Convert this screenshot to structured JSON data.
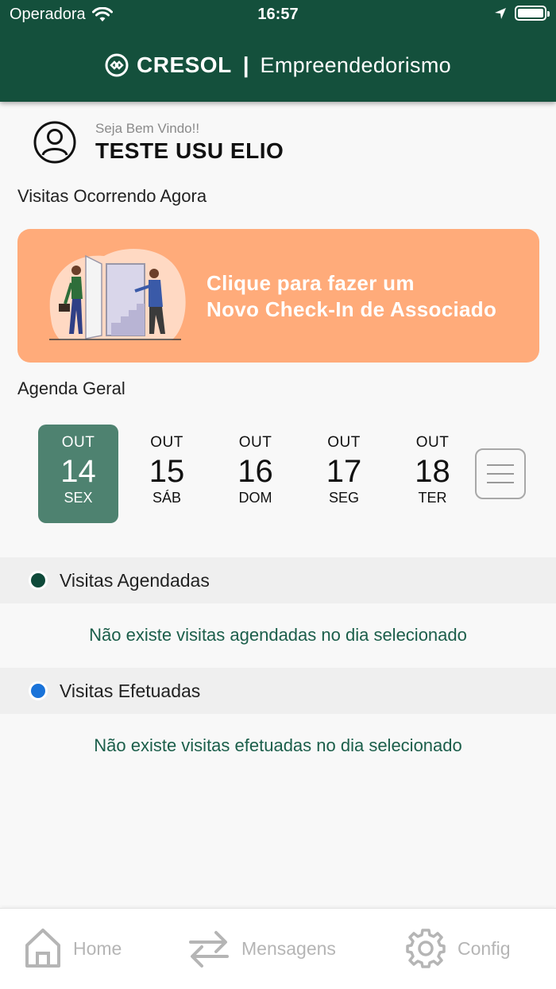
{
  "status_bar": {
    "carrier": "Operadora",
    "time": "16:57"
  },
  "header": {
    "brand": "CRESOL",
    "separator": "|",
    "app_name": "Empreendedorismo"
  },
  "user": {
    "greeting": "Seja Bem Vindo!!",
    "name": "TESTE USU ELIO"
  },
  "visits_now": {
    "title": "Visitas Ocorrendo Agora"
  },
  "checkin": {
    "line1": "Clique para fazer um",
    "line2": "Novo Check-In de Associado"
  },
  "agenda": {
    "title": "Agenda Geral",
    "days": [
      {
        "month": "OUT",
        "day": "14",
        "weekday": "SEX",
        "selected": true
      },
      {
        "month": "OUT",
        "day": "15",
        "weekday": "SÁB",
        "selected": false
      },
      {
        "month": "OUT",
        "day": "16",
        "weekday": "DOM",
        "selected": false
      },
      {
        "month": "OUT",
        "day": "17",
        "weekday": "SEG",
        "selected": false
      },
      {
        "month": "OUT",
        "day": "18",
        "weekday": "TER",
        "selected": false
      }
    ]
  },
  "scheduled": {
    "title": "Visitas Agendadas",
    "empty": "Não existe visitas agendadas no dia selecionado",
    "dot_color": "#0f4a3a"
  },
  "done": {
    "title": "Visitas Efetuadas",
    "empty": "Não existe visitas efetuadas no dia selecionado",
    "dot_color": "#1a73d9"
  },
  "tabbar": {
    "home": "Home",
    "messages": "Mensagens",
    "config": "Config"
  },
  "colors": {
    "header": "#14503c",
    "accent": "#4e8270",
    "checkin_bg": "#ffab7a"
  }
}
